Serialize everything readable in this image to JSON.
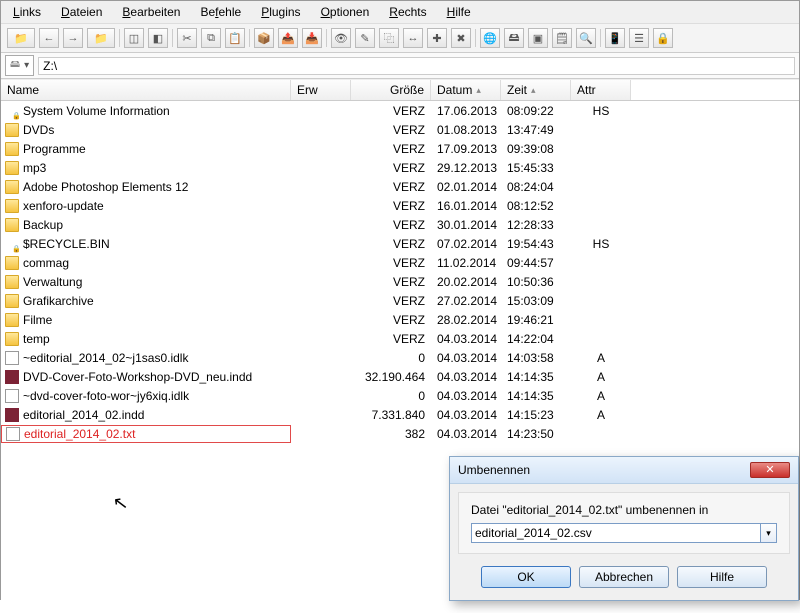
{
  "menu": {
    "items": [
      {
        "label": "Links",
        "ul": 0
      },
      {
        "label": "Dateien",
        "ul": 0
      },
      {
        "label": "Bearbeiten",
        "ul": 0
      },
      {
        "label": "Befehle",
        "ul": 2
      },
      {
        "label": "Plugins",
        "ul": 0
      },
      {
        "label": "Optionen",
        "ul": 0
      },
      {
        "label": "Rechts",
        "ul": 0
      },
      {
        "label": "Hilfe",
        "ul": 0
      }
    ]
  },
  "drive": {
    "letter": "Z:\\"
  },
  "headers": {
    "name": "Name",
    "ext": "Erw",
    "size": "Größe",
    "date": "Datum",
    "time": "Zeit",
    "attr": "Attr"
  },
  "rows": [
    {
      "icon": "folderlock",
      "name": "System Volume Information",
      "size": "VERZ",
      "date": "17.06.2013",
      "time": "08:09:22",
      "attr": "HS"
    },
    {
      "icon": "folder",
      "name": "DVDs",
      "size": "VERZ",
      "date": "01.08.2013",
      "time": "13:47:49",
      "attr": ""
    },
    {
      "icon": "folder",
      "name": "Programme",
      "size": "VERZ",
      "date": "17.09.2013",
      "time": "09:39:08",
      "attr": ""
    },
    {
      "icon": "folder",
      "name": "mp3",
      "size": "VERZ",
      "date": "29.12.2013",
      "time": "15:45:33",
      "attr": ""
    },
    {
      "icon": "folder",
      "name": "Adobe Photoshop Elements 12",
      "size": "VERZ",
      "date": "02.01.2014",
      "time": "08:24:04",
      "attr": ""
    },
    {
      "icon": "folder",
      "name": "xenforo-update",
      "size": "VERZ",
      "date": "16.01.2014",
      "time": "08:12:52",
      "attr": ""
    },
    {
      "icon": "folder",
      "name": "Backup",
      "size": "VERZ",
      "date": "30.01.2014",
      "time": "12:28:33",
      "attr": ""
    },
    {
      "icon": "folderlock",
      "name": "$RECYCLE.BIN",
      "size": "VERZ",
      "date": "07.02.2014",
      "time": "19:54:43",
      "attr": "HS"
    },
    {
      "icon": "folder",
      "name": "commag",
      "size": "VERZ",
      "date": "11.02.2014",
      "time": "09:44:57",
      "attr": ""
    },
    {
      "icon": "folder",
      "name": "Verwaltung",
      "size": "VERZ",
      "date": "20.02.2014",
      "time": "10:50:36",
      "attr": ""
    },
    {
      "icon": "folder",
      "name": "Grafikarchive",
      "size": "VERZ",
      "date": "27.02.2014",
      "time": "15:03:09",
      "attr": ""
    },
    {
      "icon": "folder",
      "name": "Filme",
      "size": "VERZ",
      "date": "28.02.2014",
      "time": "19:46:21",
      "attr": ""
    },
    {
      "icon": "folder",
      "name": "temp",
      "size": "VERZ",
      "date": "04.03.2014",
      "time": "14:22:04",
      "attr": ""
    },
    {
      "icon": "txt",
      "name": "~editorial_2014_02~j1sas0.idlk",
      "size": "0",
      "date": "04.03.2014",
      "time": "14:03:58",
      "attr": "A"
    },
    {
      "icon": "indd",
      "name": "DVD-Cover-Foto-Workshop-DVD_neu.indd",
      "size": "32.190.464",
      "date": "04.03.2014",
      "time": "14:14:35",
      "attr": "A"
    },
    {
      "icon": "txt",
      "name": "~dvd-cover-foto-wor~jy6xiq.idlk",
      "size": "0",
      "date": "04.03.2014",
      "time": "14:14:35",
      "attr": "A"
    },
    {
      "icon": "indd",
      "name": "editorial_2014_02.indd",
      "size": "7.331.840",
      "date": "04.03.2014",
      "time": "14:15:23",
      "attr": "A"
    },
    {
      "icon": "txt",
      "name": "editorial_2014_02.txt",
      "size": "382",
      "date": "04.03.2014",
      "time": "14:23:50",
      "attr": "",
      "selected": true
    }
  ],
  "dialog": {
    "title": "Umbenennen",
    "prompt": "Datei \"editorial_2014_02.txt\" umbenennen in",
    "value": "editorial_2014_02.csv",
    "ok": "OK",
    "cancel": "Abbrechen",
    "help": "Hilfe"
  },
  "toolbar": {
    "icons": [
      "open-dropdown",
      "back",
      "fwd",
      "updir",
      "sep",
      "dotted-a",
      "dotted-b",
      "sep",
      "cut",
      "copy",
      "paste",
      "sep",
      "zip",
      "unzip",
      "arch",
      "sep",
      "view",
      "edit",
      "copyfiles",
      "move",
      "newdir",
      "delete",
      "sep",
      "ftp",
      "netdrive",
      "cmd",
      "notepad",
      "search",
      "sep",
      "phone",
      "tree",
      "lock"
    ],
    "glyphs": {
      "open-dropdown": "📁",
      "back": "←",
      "fwd": "→",
      "updir": "📁",
      "dotted-a": "◫",
      "dotted-b": "◧",
      "cut": "✂",
      "copy": "⧉",
      "paste": "📋",
      "zip": "📦",
      "unzip": "📤",
      "arch": "📥",
      "view": "👁",
      "edit": "✎",
      "copyfiles": "⿻",
      "move": "↔",
      "newdir": "✚",
      "delete": "✖",
      "ftp": "🌐",
      "netdrive": "🖴",
      "cmd": "▣",
      "notepad": "🗒",
      "search": "🔍",
      "phone": "📱",
      "tree": "☰",
      "lock": "🔒"
    }
  }
}
